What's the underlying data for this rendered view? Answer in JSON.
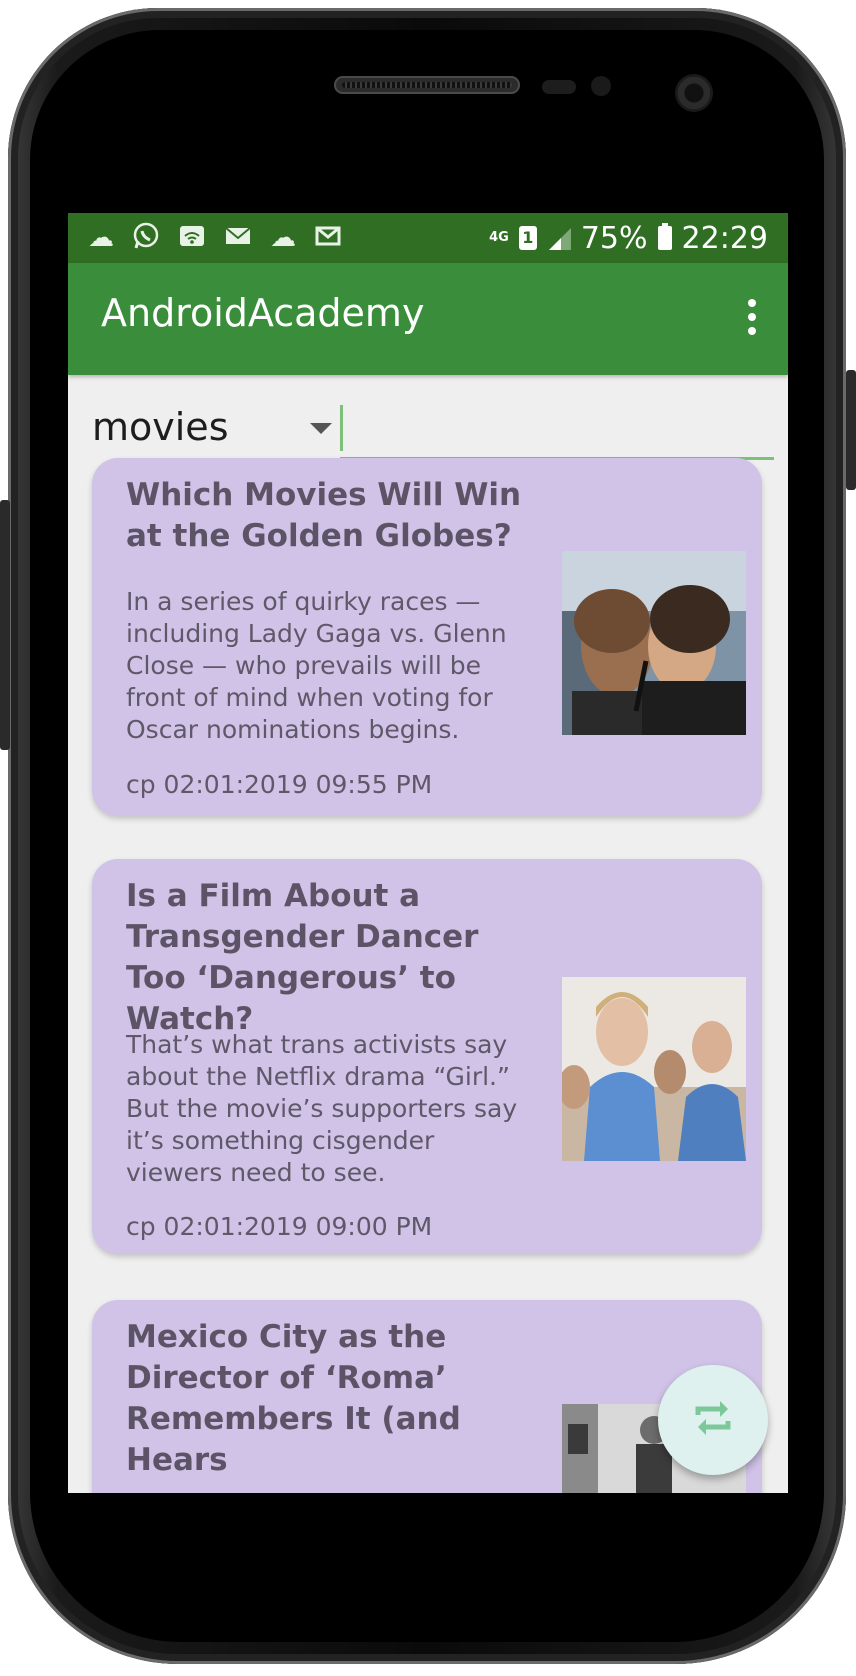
{
  "status_bar": {
    "network": "4G",
    "sim": "1",
    "battery": "75%",
    "time": "22:29",
    "icons": [
      "cloud-icon",
      "whatsapp-icon",
      "wifi-icon",
      "mail-icon",
      "cloud-icon",
      "gmail-icon"
    ]
  },
  "app_bar": {
    "title": "AndroidAcademy"
  },
  "search": {
    "selected_section": "movies",
    "query": ""
  },
  "articles": [
    {
      "title": "Which Movies Will Win at the Golden Globes?",
      "abstract": "In a series of quirky races — including Lady Gaga vs. Glenn Close — who prevails will be front of mind when voting for Oscar nominations begins.",
      "date": "cp 02:01:2019 09:55 PM"
    },
    {
      "title": "Is a Film About a Transgender Dancer Too ‘Dangerous’ to Watch?",
      "abstract": "That’s what trans activists say about the Netflix drama “Girl.” But the movie’s supporters say it’s something cisgender viewers need to see.",
      "date": "cp 02:01:2019 09:00 PM"
    },
    {
      "title": "Mexico City as the Director of ‘Roma’ Remembers It (and Hears",
      "abstract": "",
      "date": ""
    }
  ],
  "colors": {
    "status_bar": "#2f6e23",
    "app_bar": "#3a8e3b",
    "card": "#d0c3e7",
    "accent": "#7cc07c",
    "fab": "#dff1ee"
  }
}
